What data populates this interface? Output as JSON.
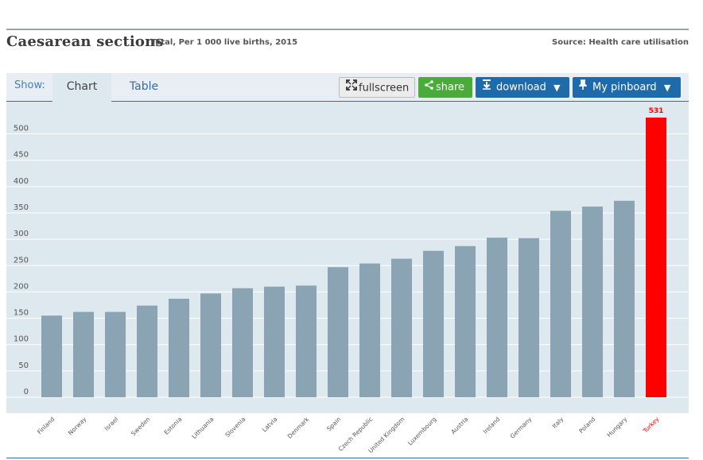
{
  "header": {
    "title": "Caesarean sections",
    "subtitle": "Total, Per 1 000 live births, 2015",
    "source": "Source: Health care utilisation"
  },
  "toolbar": {
    "show_label": "Show:",
    "tabs": [
      {
        "label": "Chart",
        "active": true
      },
      {
        "label": "Table",
        "active": false
      }
    ],
    "fullscreen_label": "fullscreen",
    "share_label": "share",
    "download_label": "download",
    "pinboard_label": "My pinboard"
  },
  "colors": {
    "bar": "#8aa4b3",
    "highlight": "#ff0000",
    "chart_bg": "#dde8ef",
    "share_bg": "#4aab3b",
    "primary_bg": "#1f6aa8"
  },
  "chart_data": {
    "type": "bar",
    "categories": [
      "Finland",
      "Norway",
      "Israel",
      "Sweden",
      "Estonia",
      "Lithuania",
      "Slovenia",
      "Latvia",
      "Denmark",
      "Spain",
      "Czech Republic",
      "United Kingdom",
      "Luxembourg",
      "Austria",
      "Ireland",
      "Germany",
      "Italy",
      "Poland",
      "Hungary",
      "Turkey"
    ],
    "values": [
      155,
      162,
      162,
      174,
      187,
      197,
      207,
      210,
      212,
      247,
      254,
      263,
      278,
      287,
      303,
      302,
      354,
      362,
      373,
      531
    ],
    "highlight": "Turkey",
    "data_labels": [
      {
        "category": "Turkey",
        "text": "531"
      }
    ],
    "yticks": [
      0,
      50,
      100,
      150,
      200,
      250,
      300,
      350,
      400,
      450,
      500
    ],
    "ylim": [
      0,
      531
    ],
    "grid": true,
    "xlabel": "",
    "ylabel": ""
  }
}
